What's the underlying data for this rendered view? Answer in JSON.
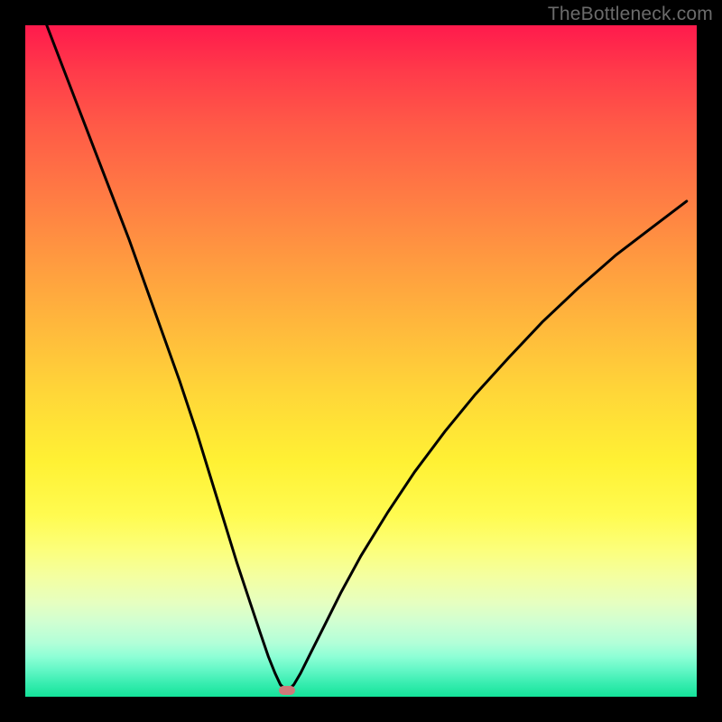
{
  "watermark": "TheBottleneck.com",
  "marker": {
    "x_frac": 0.39,
    "y_frac": 0.99
  },
  "chart_data": {
    "type": "line",
    "title": "",
    "xlabel": "",
    "ylabel": "",
    "xlim": [
      0,
      1
    ],
    "ylim": [
      0,
      1
    ],
    "grid": false,
    "legend": "none",
    "annotations": [
      "TheBottleneck.com"
    ],
    "background": {
      "type": "vertical-gradient",
      "stops": [
        {
          "pos": 0.0,
          "color": "#ff1a4c"
        },
        {
          "pos": 0.35,
          "color": "#ff9a40"
        },
        {
          "pos": 0.65,
          "color": "#fff134"
        },
        {
          "pos": 0.82,
          "color": "#f4ffa0"
        },
        {
          "pos": 1.0,
          "color": "#14e39a"
        }
      ]
    },
    "min_marker": {
      "x": 0.39,
      "y": 0.01,
      "color": "#cf7a7a"
    },
    "series": [
      {
        "name": "left-branch",
        "x": [
          0.032,
          0.055,
          0.08,
          0.105,
          0.13,
          0.155,
          0.18,
          0.205,
          0.23,
          0.255,
          0.275,
          0.295,
          0.315,
          0.335,
          0.35,
          0.362,
          0.372,
          0.38,
          0.388
        ],
        "y": [
          1.0,
          0.94,
          0.875,
          0.81,
          0.745,
          0.68,
          0.61,
          0.54,
          0.47,
          0.395,
          0.33,
          0.265,
          0.2,
          0.14,
          0.095,
          0.06,
          0.035,
          0.018,
          0.01
        ]
      },
      {
        "name": "right-branch",
        "x": [
          0.392,
          0.4,
          0.41,
          0.425,
          0.445,
          0.47,
          0.5,
          0.54,
          0.58,
          0.625,
          0.67,
          0.72,
          0.77,
          0.825,
          0.88,
          0.935,
          0.985
        ],
        "y": [
          0.01,
          0.018,
          0.035,
          0.065,
          0.105,
          0.155,
          0.21,
          0.275,
          0.335,
          0.395,
          0.45,
          0.505,
          0.558,
          0.61,
          0.658,
          0.7,
          0.738
        ]
      }
    ]
  }
}
